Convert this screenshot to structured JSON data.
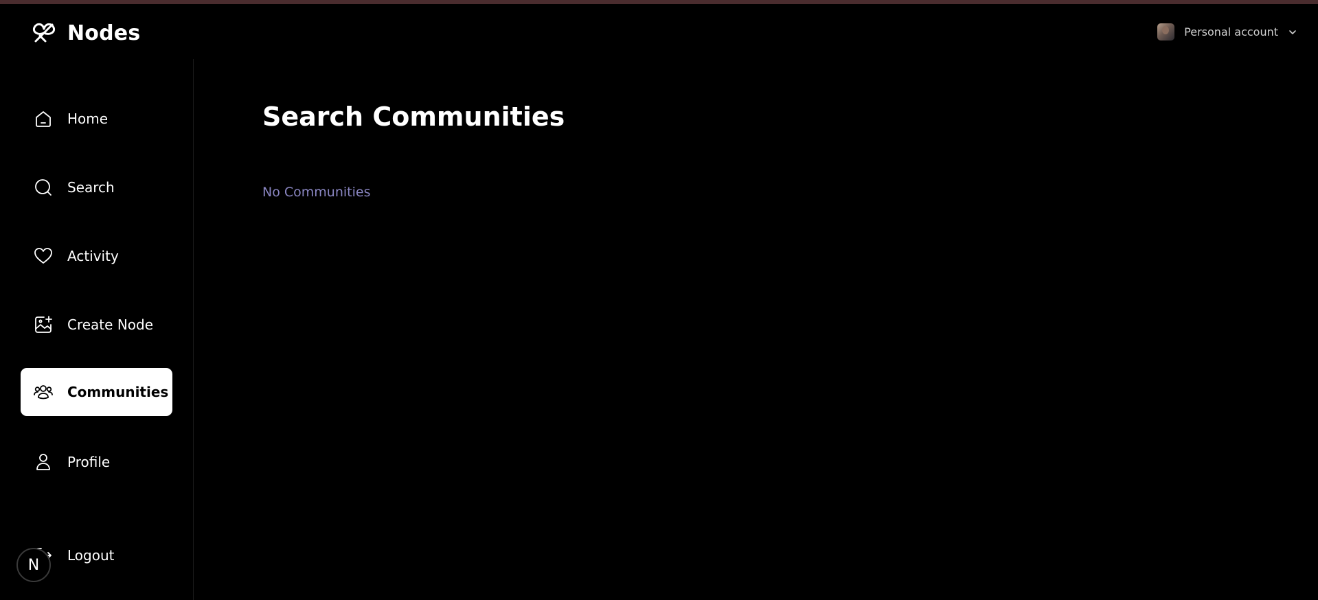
{
  "app": {
    "name": "Nodes"
  },
  "account": {
    "label": "Personal account"
  },
  "sidebar": {
    "items": [
      {
        "label": "Home",
        "icon": "home-icon"
      },
      {
        "label": "Search",
        "icon": "search-icon"
      },
      {
        "label": "Activity",
        "icon": "heart-icon"
      },
      {
        "label": "Create Node",
        "icon": "image-plus-icon"
      },
      {
        "label": "Communities",
        "icon": "users-icon",
        "active": true
      },
      {
        "label": "Profile",
        "icon": "user-icon"
      }
    ],
    "logout_label": "Logout",
    "badge": "N"
  },
  "main": {
    "title": "Search Communities",
    "empty_message": "No Communities"
  },
  "colors": {
    "background": "#000000",
    "accent_text": "#8a86c2",
    "top_stripe": "#4a2c2e",
    "active_item_bg": "#ffffff"
  }
}
